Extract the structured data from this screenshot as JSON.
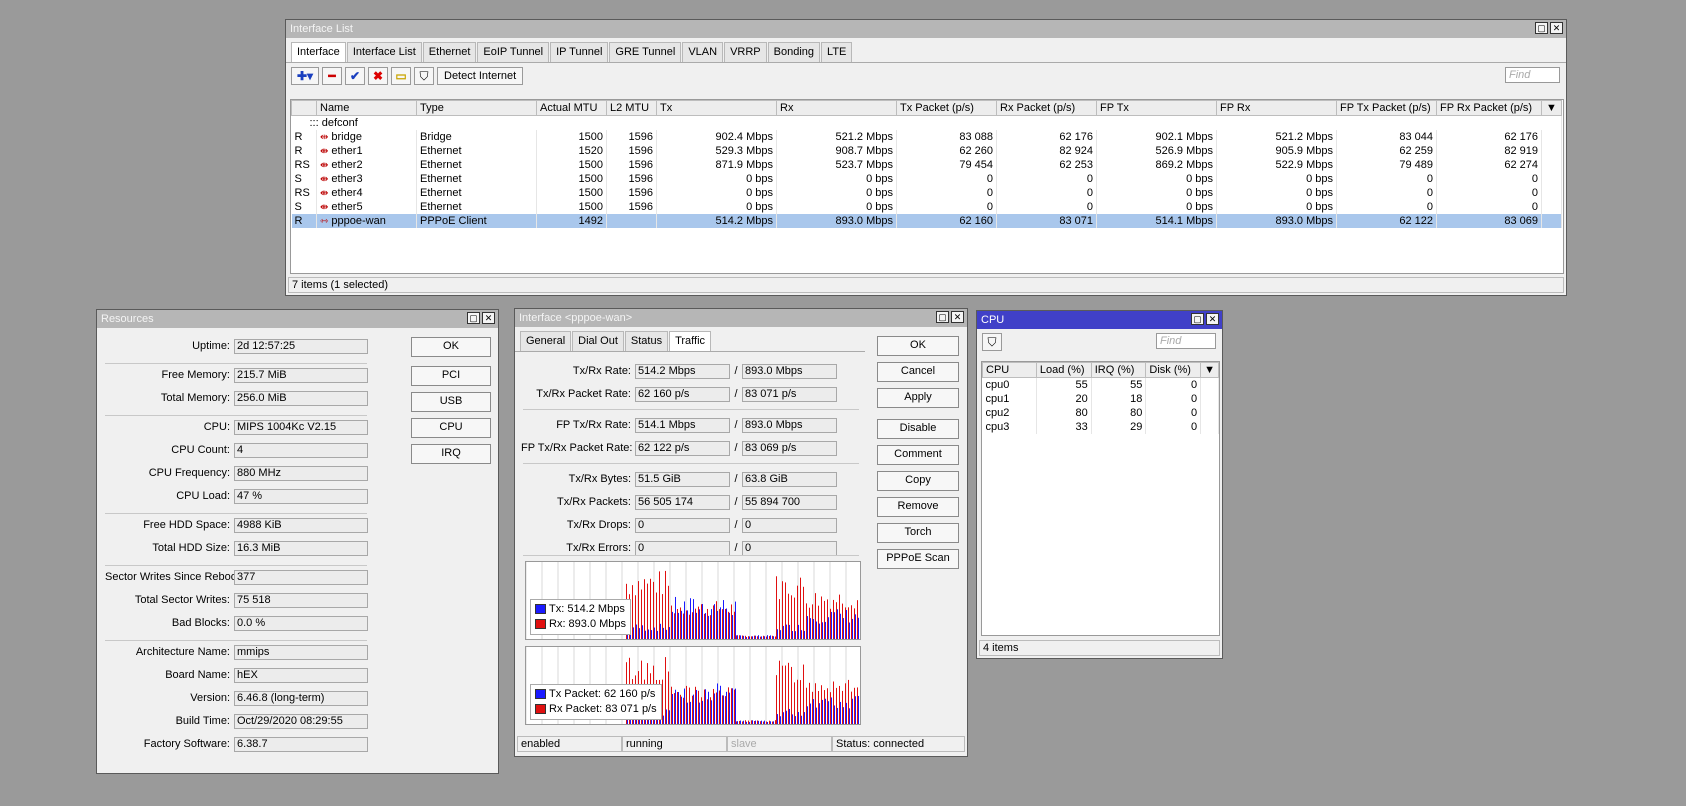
{
  "iface_list": {
    "title": "Interface List",
    "tabs": [
      "Interface",
      "Interface List",
      "Ethernet",
      "EoIP Tunnel",
      "IP Tunnel",
      "GRE Tunnel",
      "VLAN",
      "VRRP",
      "Bonding",
      "LTE"
    ],
    "toolbar": {
      "detect_internet": "Detect Internet",
      "find_placeholder": "Find"
    },
    "columns": [
      "",
      "Name",
      "Type",
      "Actual MTU",
      "L2 MTU",
      "Tx",
      "Rx",
      "Tx Packet (p/s)",
      "Rx Packet (p/s)",
      "FP Tx",
      "FP Rx",
      "FP Tx Packet (p/s)",
      "FP Rx Packet (p/s)"
    ],
    "group": "::: defconf",
    "rows": [
      {
        "flag": "R",
        "name": "bridge",
        "icon": "bridge-icon",
        "type": "Bridge",
        "amtu": "1500",
        "l2mtu": "1596",
        "tx": "902.4 Mbps",
        "rx": "521.2 Mbps",
        "txp": "83 088",
        "rxp": "62 176",
        "fptx": "902.1 Mbps",
        "fprx": "521.2 Mbps",
        "fptxp": "83 044",
        "fprxp": "62 176"
      },
      {
        "flag": "R",
        "name": "ether1",
        "icon": "ethernet-icon",
        "type": "Ethernet",
        "amtu": "1520",
        "l2mtu": "1596",
        "tx": "529.3 Mbps",
        "rx": "908.7 Mbps",
        "txp": "62 260",
        "rxp": "82 924",
        "fptx": "526.9 Mbps",
        "fprx": "905.9 Mbps",
        "fptxp": "62 259",
        "fprxp": "82 919"
      },
      {
        "flag": "RS",
        "name": "ether2",
        "icon": "ethernet-icon",
        "type": "Ethernet",
        "amtu": "1500",
        "l2mtu": "1596",
        "tx": "871.9 Mbps",
        "rx": "523.7 Mbps",
        "txp": "79 454",
        "rxp": "62 253",
        "fptx": "869.2 Mbps",
        "fprx": "522.9 Mbps",
        "fptxp": "79 489",
        "fprxp": "62 274"
      },
      {
        "flag": "S",
        "name": "ether3",
        "icon": "ethernet-icon",
        "type": "Ethernet",
        "amtu": "1500",
        "l2mtu": "1596",
        "tx": "0 bps",
        "rx": "0 bps",
        "txp": "0",
        "rxp": "0",
        "fptx": "0 bps",
        "fprx": "0 bps",
        "fptxp": "0",
        "fprxp": "0"
      },
      {
        "flag": "RS",
        "name": "ether4",
        "icon": "ethernet-icon",
        "type": "Ethernet",
        "amtu": "1500",
        "l2mtu": "1596",
        "tx": "0 bps",
        "rx": "0 bps",
        "txp": "0",
        "rxp": "0",
        "fptx": "0 bps",
        "fprx": "0 bps",
        "fptxp": "0",
        "fprxp": "0"
      },
      {
        "flag": "S",
        "name": "ether5",
        "icon": "ethernet-icon",
        "type": "Ethernet",
        "amtu": "1500",
        "l2mtu": "1596",
        "tx": "0 bps",
        "rx": "0 bps",
        "txp": "0",
        "rxp": "0",
        "fptx": "0 bps",
        "fprx": "0 bps",
        "fptxp": "0",
        "fprxp": "0"
      },
      {
        "flag": "R",
        "name": "pppoe-wan",
        "icon": "pppoe-icon",
        "type": "PPPoE Client",
        "amtu": "1492",
        "l2mtu": "",
        "tx": "514.2 Mbps",
        "rx": "893.0 Mbps",
        "txp": "62 160",
        "rxp": "83 071",
        "fptx": "514.1 Mbps",
        "fprx": "893.0 Mbps",
        "fptxp": "62 122",
        "fprxp": "83 069",
        "selected": true
      }
    ],
    "status": "7 items (1 selected)"
  },
  "resources": {
    "title": "Resources",
    "fields": [
      {
        "label": "Uptime:",
        "value": "2d 12:57:25"
      },
      {
        "label": "Free Memory:",
        "value": "215.7 MiB"
      },
      {
        "label": "Total Memory:",
        "value": "256.0 MiB"
      },
      {
        "label": "CPU:",
        "value": "MIPS 1004Kc V2.15"
      },
      {
        "label": "CPU Count:",
        "value": "4"
      },
      {
        "label": "CPU Frequency:",
        "value": "880 MHz"
      },
      {
        "label": "CPU Load:",
        "value": "47 %"
      },
      {
        "label": "Free HDD Space:",
        "value": "4988 KiB"
      },
      {
        "label": "Total HDD Size:",
        "value": "16.3 MiB"
      },
      {
        "label": "Sector Writes Since Reboot:",
        "value": "377"
      },
      {
        "label": "Total Sector Writes:",
        "value": "75 518"
      },
      {
        "label": "Bad Blocks:",
        "value": "0.0 %"
      },
      {
        "label": "Architecture Name:",
        "value": "mmips"
      },
      {
        "label": "Board Name:",
        "value": "hEX"
      },
      {
        "label": "Version:",
        "value": "6.46.8 (long-term)"
      },
      {
        "label": "Build Time:",
        "value": "Oct/29/2020 08:29:55"
      },
      {
        "label": "Factory Software:",
        "value": "6.38.7"
      }
    ],
    "buttons": [
      "OK",
      "PCI",
      "USB",
      "CPU",
      "IRQ"
    ]
  },
  "iface": {
    "title": "Interface <pppoe-wan>",
    "tabs": [
      "General",
      "Dial Out",
      "Status",
      "Traffic"
    ],
    "rows": [
      {
        "label": "Tx/Rx Rate:",
        "a": "514.2 Mbps",
        "b": "893.0 Mbps"
      },
      {
        "label": "Tx/Rx Packet Rate:",
        "a": "62 160 p/s",
        "b": "83 071 p/s"
      },
      {
        "label": "FP Tx/Rx Rate:",
        "a": "514.1 Mbps",
        "b": "893.0 Mbps"
      },
      {
        "label": "FP Tx/Rx Packet Rate:",
        "a": "62 122 p/s",
        "b": "83 069 p/s"
      },
      {
        "label": "Tx/Rx Bytes:",
        "a": "51.5 GiB",
        "b": "63.8 GiB"
      },
      {
        "label": "Tx/Rx Packets:",
        "a": "56 505 174",
        "b": "55 894 700"
      },
      {
        "label": "Tx/Rx Drops:",
        "a": "0",
        "b": "0"
      },
      {
        "label": "Tx/Rx Errors:",
        "a": "0",
        "b": "0"
      }
    ],
    "graph1": {
      "tx": "Tx:  514.2 Mbps",
      "rx": "Rx:  893.0 Mbps"
    },
    "graph2": {
      "tx": "Tx Packet:  62 160 p/s",
      "rx": "Rx Packet:  83 071 p/s"
    },
    "buttons": [
      "OK",
      "Cancel",
      "Apply",
      "Disable",
      "Comment",
      "Copy",
      "Remove",
      "Torch",
      "PPPoE Scan"
    ],
    "status": {
      "s1": "enabled",
      "s2": "running",
      "s3": "slave",
      "s4": "Status: connected"
    },
    "colors": {
      "tx": "#1a1aff",
      "rx": "#e01010"
    }
  },
  "cpu": {
    "title": "CPU",
    "find_placeholder": "Find",
    "columns": [
      "CPU",
      "Load (%)",
      "IRQ (%)",
      "Disk (%)"
    ],
    "rows": [
      {
        "cpu": "cpu0",
        "load": "55",
        "irq": "55",
        "disk": "0"
      },
      {
        "cpu": "cpu1",
        "load": "20",
        "irq": "18",
        "disk": "0"
      },
      {
        "cpu": "cpu2",
        "load": "80",
        "irq": "80",
        "disk": "0"
      },
      {
        "cpu": "cpu3",
        "load": "33",
        "irq": "29",
        "disk": "0"
      }
    ],
    "status": "4 items"
  }
}
